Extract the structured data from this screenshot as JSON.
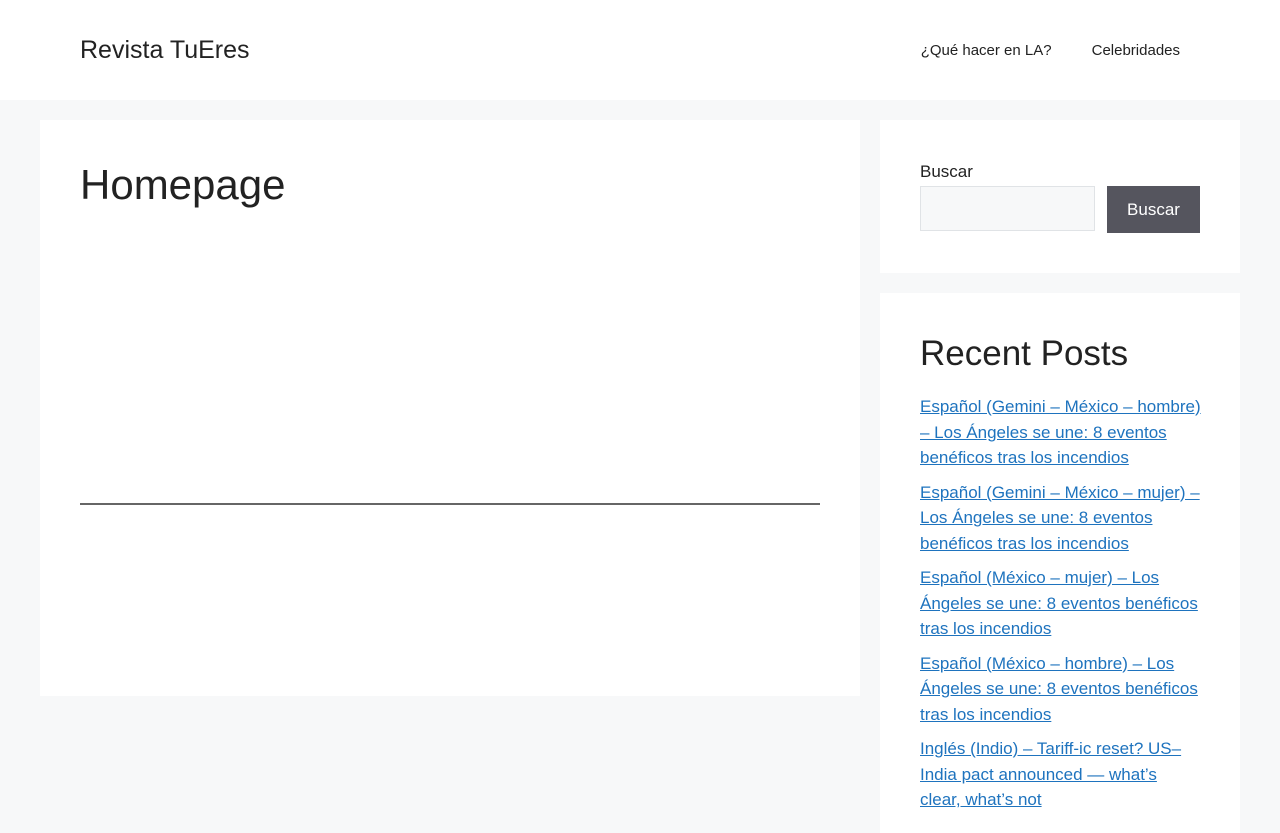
{
  "header": {
    "site_title": "Revista TuEres",
    "nav": [
      {
        "label": "¿Qué hacer en LA?"
      },
      {
        "label": "Celebridades"
      }
    ]
  },
  "main": {
    "page_title": "Homepage"
  },
  "sidebar": {
    "search": {
      "label": "Buscar",
      "input_value": "",
      "button_label": "Buscar"
    },
    "recent_posts": {
      "title": "Recent Posts",
      "items": [
        {
          "label": "Español (Gemini – México – hombre) – Los Ángeles se une: 8 eventos benéficos tras los incendios"
        },
        {
          "label": "Español (Gemini – México – mujer) – Los Ángeles se une: 8 eventos benéficos tras los incendios"
        },
        {
          "label": "Español (México – mujer) – Los Ángeles se une: 8 eventos benéficos tras los incendios"
        },
        {
          "label": "Español (México – hombre) – Los Ángeles se une: 8 eventos benéficos tras los incendios"
        },
        {
          "label": "Inglés (Indio) – Tariff-ic reset? US–India pact announced — what’s clear, what’s not"
        }
      ]
    }
  },
  "colors": {
    "background": "#f7f8f9",
    "link": "#1e73be",
    "button": "#55555e"
  }
}
